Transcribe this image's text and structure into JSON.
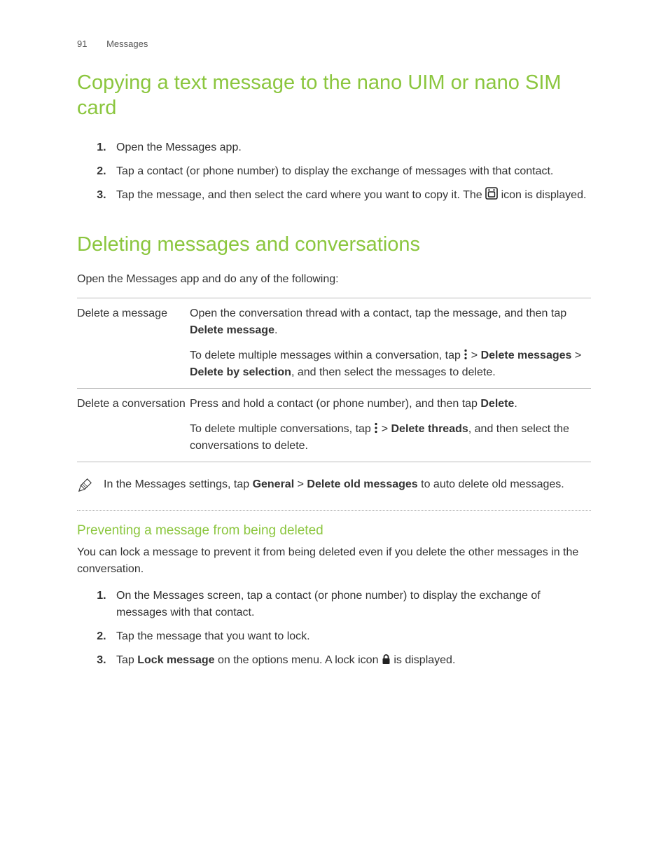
{
  "header": {
    "page_number": "91",
    "section": "Messages"
  },
  "section1": {
    "title": "Copying a text message to the nano UIM or nano SIM card",
    "step1": "Open the Messages app.",
    "step2": "Tap a contact (or phone number) to display the exchange of messages with that contact.",
    "step3_a": "Tap the message, and then select the card where you want to copy it. The ",
    "step3_b": " icon is displayed."
  },
  "section2": {
    "title": "Deleting messages and conversations",
    "intro": "Open the Messages app and do any of the following:",
    "row1_label": "Delete a message",
    "row1_p1_a": "Open the conversation thread with a contact, tap the message, and then tap ",
    "row1_p1_bold": "Delete message",
    "row1_p1_b": ".",
    "row1_p2_a": "To delete multiple messages within a conversation, tap ",
    "row1_p2_b": " > ",
    "row1_p2_bold1": "Delete messages",
    "row1_p2_c": " > ",
    "row1_p2_bold2": "Delete by selection",
    "row1_p2_d": ", and then select the messages to delete.",
    "row2_label": "Delete a conversation",
    "row2_p1_a": "Press and hold a contact (or phone number), and then tap ",
    "row2_p1_bold": "Delete",
    "row2_p1_b": ".",
    "row2_p2_a": "To delete multiple conversations, tap ",
    "row2_p2_b": " > ",
    "row2_p2_bold": "Delete threads",
    "row2_p2_c": ", and then select the conversations to delete."
  },
  "note": {
    "a": "In the Messages settings, tap ",
    "bold1": "General",
    "b": " > ",
    "bold2": "Delete old messages",
    "c": " to auto delete old messages."
  },
  "section3": {
    "title": "Preventing a message from being deleted",
    "intro": "You can lock a message to prevent it from being deleted even if you delete the other messages in the conversation.",
    "step1": "On the Messages screen, tap a contact (or phone number) to display the exchange of messages with that contact.",
    "step2": "Tap the message that you want to lock.",
    "step3_a": "Tap ",
    "step3_bold": "Lock message",
    "step3_b": " on the options menu. A lock icon ",
    "step3_c": " is displayed."
  }
}
